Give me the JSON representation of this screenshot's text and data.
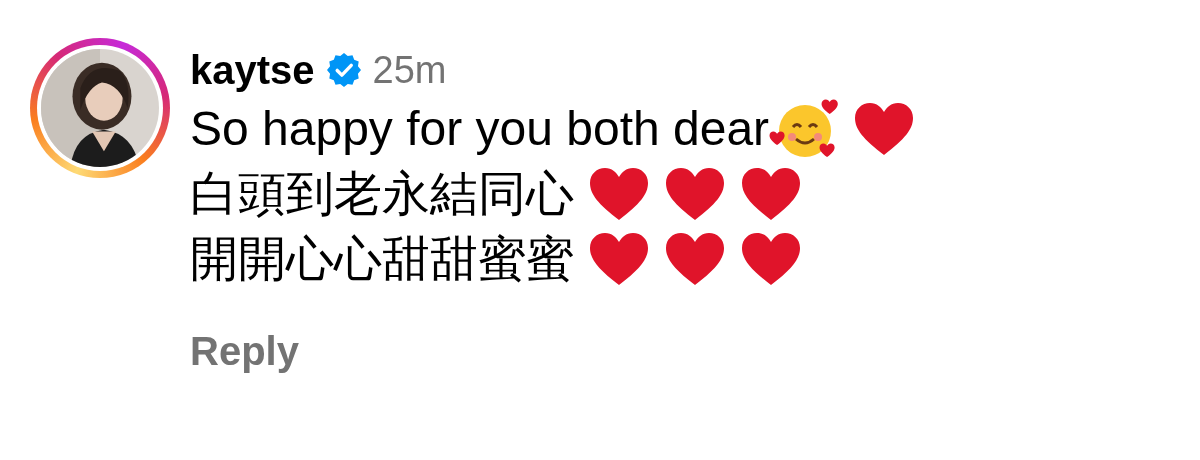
{
  "comment": {
    "author": {
      "username": "kaytse",
      "verified": true,
      "avatar": {
        "kind": "picture",
        "story_ring": true
      }
    },
    "time": "25m",
    "lines": [
      {
        "text": "So happy for you both dear",
        "emojis": [
          {
            "kind": "smiling-face-hearts"
          },
          {
            "kind": "heart"
          }
        ]
      },
      {
        "text": "白頭到老永結同心",
        "emojis": [
          {
            "kind": "heart"
          },
          {
            "kind": "heart"
          },
          {
            "kind": "heart"
          }
        ]
      },
      {
        "text": "開開心心甜甜蜜蜜",
        "emojis": [
          {
            "kind": "heart"
          },
          {
            "kind": "heart"
          },
          {
            "kind": "heart"
          }
        ]
      }
    ],
    "reply_label": "Reply"
  }
}
